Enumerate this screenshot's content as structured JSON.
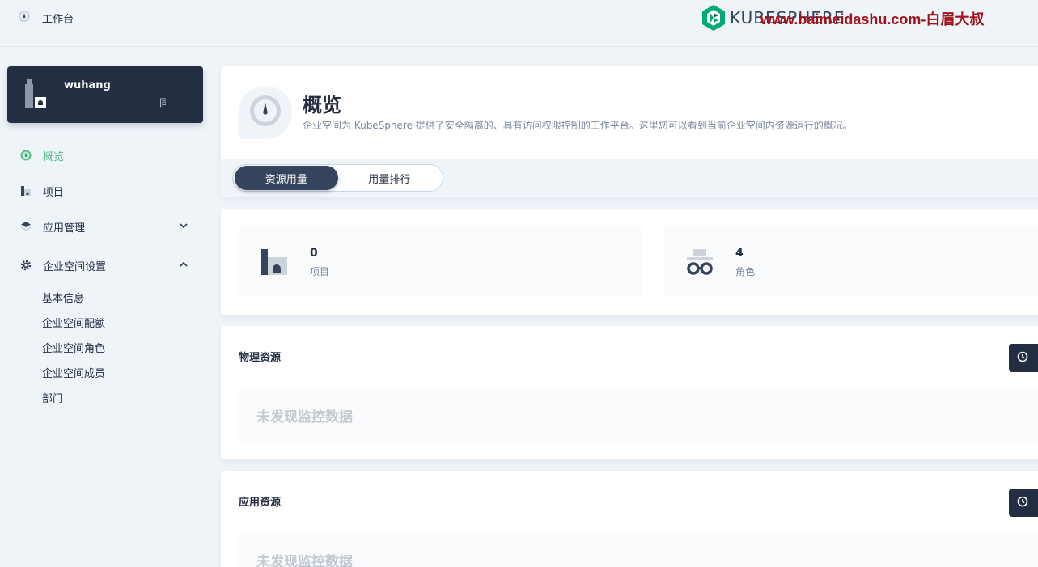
{
  "topbar": {
    "home_label": "工作台",
    "brand": "KUBESPHERE",
    "watermark": "www.baimeidashu.com-白眉大叔"
  },
  "workspace": {
    "name": "wuhang",
    "desc": "同"
  },
  "nav": {
    "items": [
      {
        "label": "概览",
        "icon": "dashboard-icon",
        "active": true
      },
      {
        "label": "项目",
        "icon": "project-icon"
      },
      {
        "label": "应用管理",
        "icon": "appstore-icon",
        "expanded": false
      },
      {
        "label": "企业空间设置",
        "icon": "gear-icon",
        "expanded": true
      }
    ],
    "sub_items": [
      "基本信息",
      "企业空间配额",
      "企业空间角色",
      "企业空间成员",
      "部门"
    ]
  },
  "overview": {
    "title": "概览",
    "description": "企业空间为 KubeSphere 提供了安全隔离的、具有访问权限控制的工作平台。这里您可以看到当前企业空间内资源运行的概况。",
    "tabs": [
      "资源用量",
      "用量排行"
    ],
    "active_tab": 0
  },
  "stats": [
    {
      "value": "0",
      "label": "项目",
      "icon": "project-icon"
    },
    {
      "value": "4",
      "label": "角色",
      "icon": "role-icon"
    }
  ],
  "sections": {
    "physical": {
      "title": "物理资源",
      "empty": "未发现监控数据"
    },
    "application": {
      "title": "应用资源",
      "empty": "未发现监控数据"
    }
  },
  "colors": {
    "accent": "#55bc8a",
    "dark": "#242e42",
    "background": "#eff4f9",
    "watermark": "#a3111a"
  }
}
